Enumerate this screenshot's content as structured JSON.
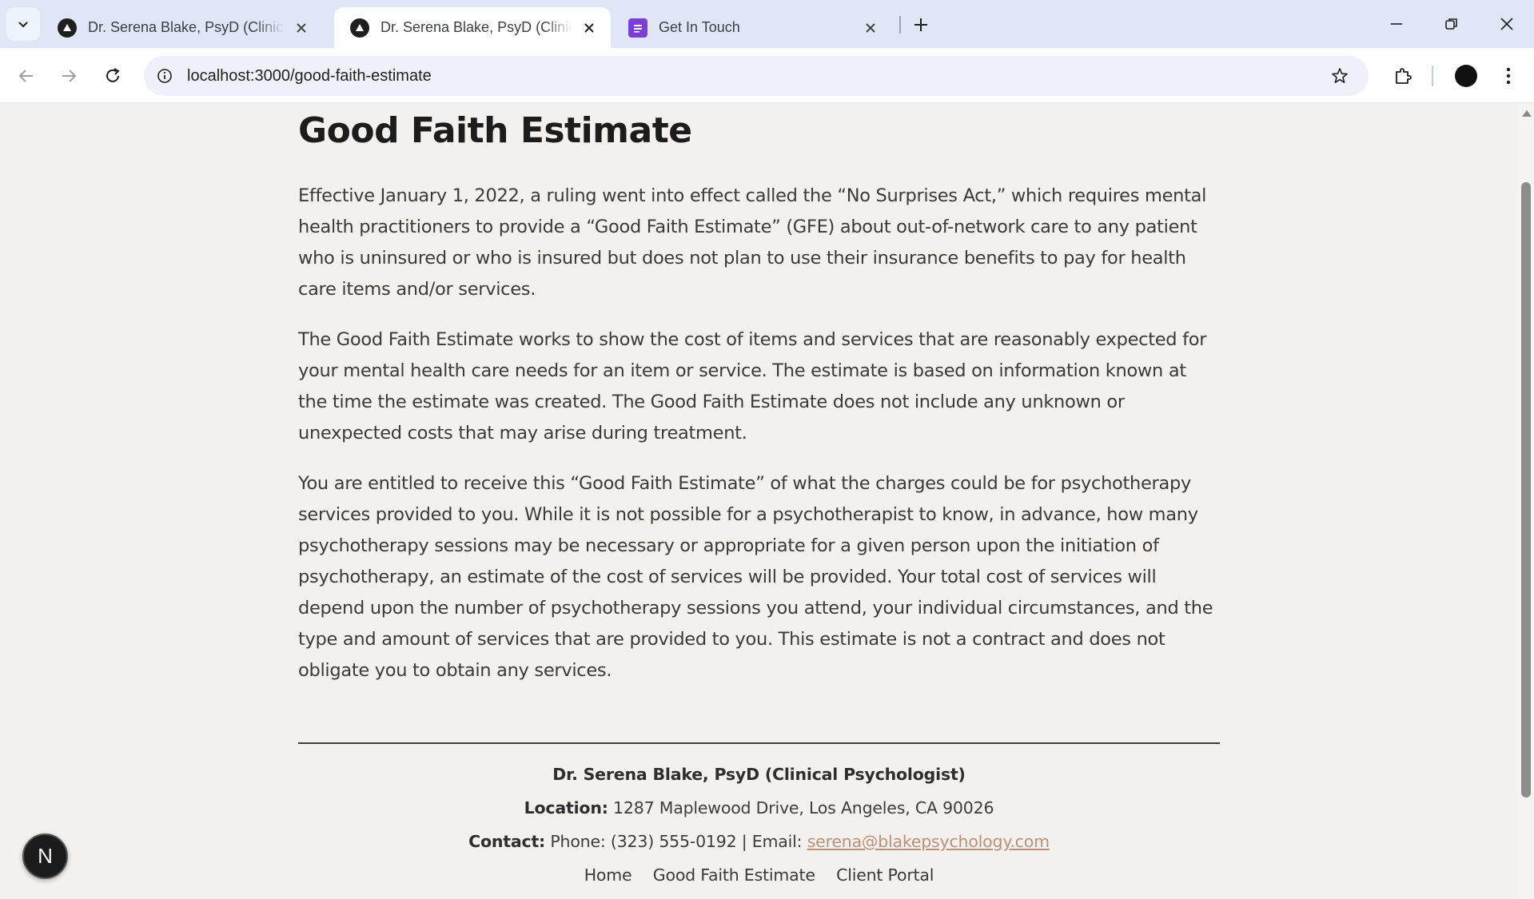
{
  "browser": {
    "tabs": [
      {
        "title": "Dr. Serena Blake, PsyD (Clinical Psychologist)",
        "icon": "triangle-logo-icon",
        "active": false
      },
      {
        "title": "Dr. Serena Blake, PsyD (Clinical Psychologist)",
        "icon": "triangle-logo-icon",
        "active": true
      },
      {
        "title": "Get In Touch",
        "icon": "forms-icon",
        "active": false
      }
    ],
    "url": "localhost:3000/good-faith-estimate"
  },
  "page": {
    "title": "Good Faith Estimate",
    "paragraphs": [
      "Effective January 1, 2022, a ruling went into effect called the “No Surprises Act,” which requires mental health practitioners to provide a “Good Faith Estimate” (GFE) about out-of-network care to any patient who is uninsured or who is insured but does not plan to use their insurance benefits to pay for health care items and/or services.",
      "The Good Faith Estimate works to show the cost of items and services that are reasonably expected for your mental health care needs for an item or service. The estimate is based on information known at the time the estimate was created. The Good Faith Estimate does not include any unknown or unexpected costs that may arise during treatment.",
      "You are entitled to receive this “Good Faith Estimate” of what the charges could be for psychotherapy services provided to you. While it is not possible for a psychotherapist to know, in advance, how many psychotherapy sessions may be necessary or appropriate for a given person upon the initiation of psychotherapy, an estimate of the cost of services will be provided. Your total cost of services will depend upon the number of psychotherapy sessions you attend, your individual circumstances, and the type and amount of services that are provided to you. This estimate is not a contract and does not obligate you to obtain any services."
    ]
  },
  "footer": {
    "name": "Dr. Serena Blake, PsyD (Clinical Psychologist)",
    "location_label": "Location:",
    "location": "1287 Maplewood Drive, Los Angeles, CA 90026",
    "contact_label": "Contact:",
    "contact_text": "Phone: (323) 555-0192 | Email:",
    "email": "serena@blakepsychology.com",
    "links": [
      "Home",
      "Good Faith Estimate",
      "Client Portal"
    ]
  },
  "dev_badge": {
    "label": "N"
  },
  "colors": {
    "page_bg": "#f4f0ed",
    "email_link": "#b9917a",
    "tabbar_bg": "#dfe7f7"
  }
}
